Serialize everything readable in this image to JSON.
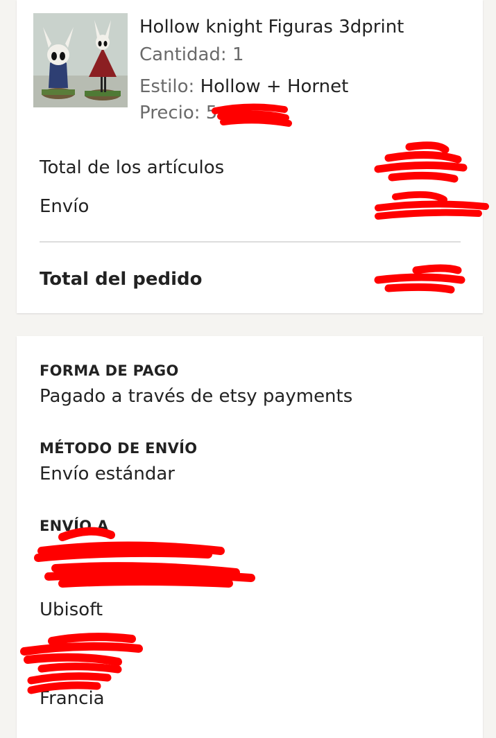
{
  "order_item": {
    "title": "Hollow knight Figuras 3dprint",
    "quantity_label": "Cantidad:",
    "quantity_value": "1",
    "style_label": "Estilo:",
    "style_value": "Hollow + Hornet",
    "price_label": "Precio:",
    "price_visible": "5",
    "thumbnail_icon": "product-photo-figures"
  },
  "summary": {
    "items_total_label": "Total de los artículos",
    "shipping_label": "Envío",
    "order_total_label": "Total del pedido"
  },
  "details": {
    "payment_heading": "FORMA DE PAGO",
    "payment_value": "Pagado a través de etsy payments",
    "shipping_method_heading": "MÉTODO DE ENVÍO",
    "shipping_method_value": "Envío estándar",
    "ship_to_heading": "ENVÍO A",
    "address_company": "Ubisoft",
    "address_country": "Francia"
  },
  "colors": {
    "redaction": "#ff0000",
    "muted_text": "#6a6a6a",
    "background": "#f5f4f1"
  }
}
